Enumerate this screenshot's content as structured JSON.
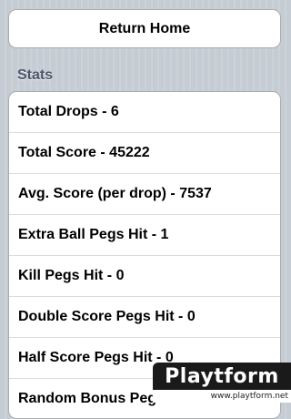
{
  "return_button": {
    "label": "Return Home"
  },
  "stats": {
    "header": "Stats",
    "rows": [
      {
        "label": "Total Drops - 6"
      },
      {
        "label": "Total Score - 45222"
      },
      {
        "label": "Avg. Score (per drop) - 7537"
      },
      {
        "label": "Extra Ball Pegs Hit - 1"
      },
      {
        "label": "Kill Pegs Hit - 0"
      },
      {
        "label": "Double Score Pegs Hit - 0"
      },
      {
        "label": "Half Score Pegs Hit - 0"
      },
      {
        "label": "Random Bonus Pegs Hit"
      }
    ]
  },
  "watermark": {
    "name": "Playtform",
    "url": "www.playtform.net"
  }
}
